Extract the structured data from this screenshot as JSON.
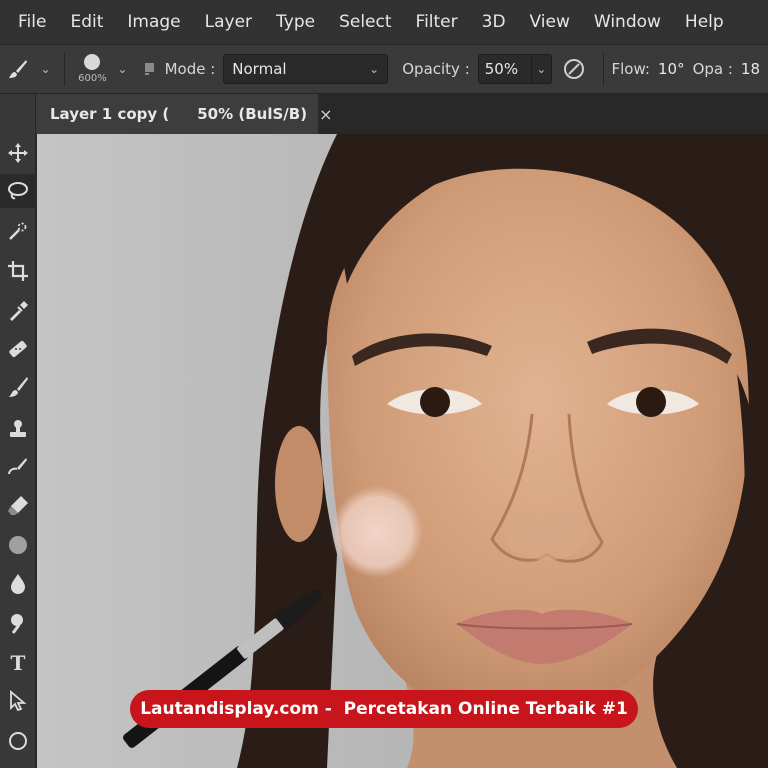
{
  "menubar": {
    "items": [
      "File",
      "Edit",
      "Image",
      "Layer",
      "Type",
      "Select",
      "Filter",
      "3D",
      "View",
      "Window",
      "Help"
    ]
  },
  "options": {
    "brush_size": "600%",
    "mode_label": "Mode :",
    "mode_value": "Normal",
    "opacity_label": "Opacity :",
    "opacity_value": "50%",
    "flow_label": "Flow:",
    "flow_value": "10°",
    "opa_label": "Opa :",
    "opa_value": "18"
  },
  "document": {
    "tab_name": "Layer 1 copy (",
    "tab_zoom": "50% (BulS/B)",
    "close_glyph": "×"
  },
  "toolbar": {
    "tools": [
      "move-tool",
      "lasso-tool",
      "quick-select-tool",
      "crop-tool",
      "eyedropper-tool",
      "healing-tool",
      "brush-tool",
      "stamp-tool",
      "history-brush-tool",
      "eraser-tool",
      "gradient-tool",
      "blur-tool",
      "dodge-tool",
      "pen-tool",
      "type-tool",
      "path-select-tool",
      "shape-tool"
    ],
    "active": "lasso-tool",
    "type_glyph": "T"
  },
  "banner": {
    "text": "Lautandisplay.com -  Percetakan Online Terbaik #1",
    "color": "#c8141b"
  },
  "colors": {
    "menubar_bg": "#323232",
    "optbar_bg": "#3a3a3a",
    "canvas_bg": "#b8b8b8"
  }
}
